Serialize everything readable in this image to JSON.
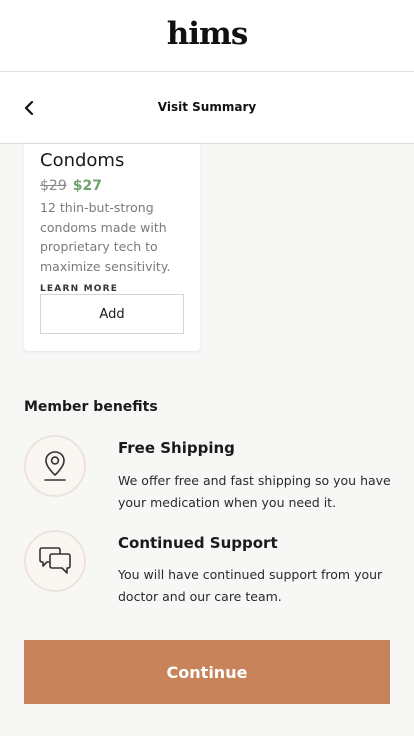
{
  "header": {
    "logo": "hims"
  },
  "nav": {
    "title": "Visit Summary",
    "back_icon": "chevron-left-icon"
  },
  "product_card": {
    "title": "Condoms",
    "old_price": "$29",
    "new_price": "$27",
    "description": "12 thin-but-strong condoms made with proprietary tech to maximize sensitivity.",
    "learn_more": "LEARN MORE",
    "add_label": "Add"
  },
  "benefits": {
    "title": "Member benefits",
    "items": [
      {
        "icon": "map-pin-icon",
        "title": "Free Shipping",
        "text": "We offer free and fast shipping so you have your medication when you need it."
      },
      {
        "icon": "chat-bubbles-icon",
        "title": "Continued Support",
        "text": "You will have continued support from your doctor and our care team."
      }
    ]
  },
  "continue_label": "Continue",
  "colors": {
    "accent": "#c9835a",
    "sale_price": "#6ea36e",
    "background": "#f7f7f6"
  }
}
